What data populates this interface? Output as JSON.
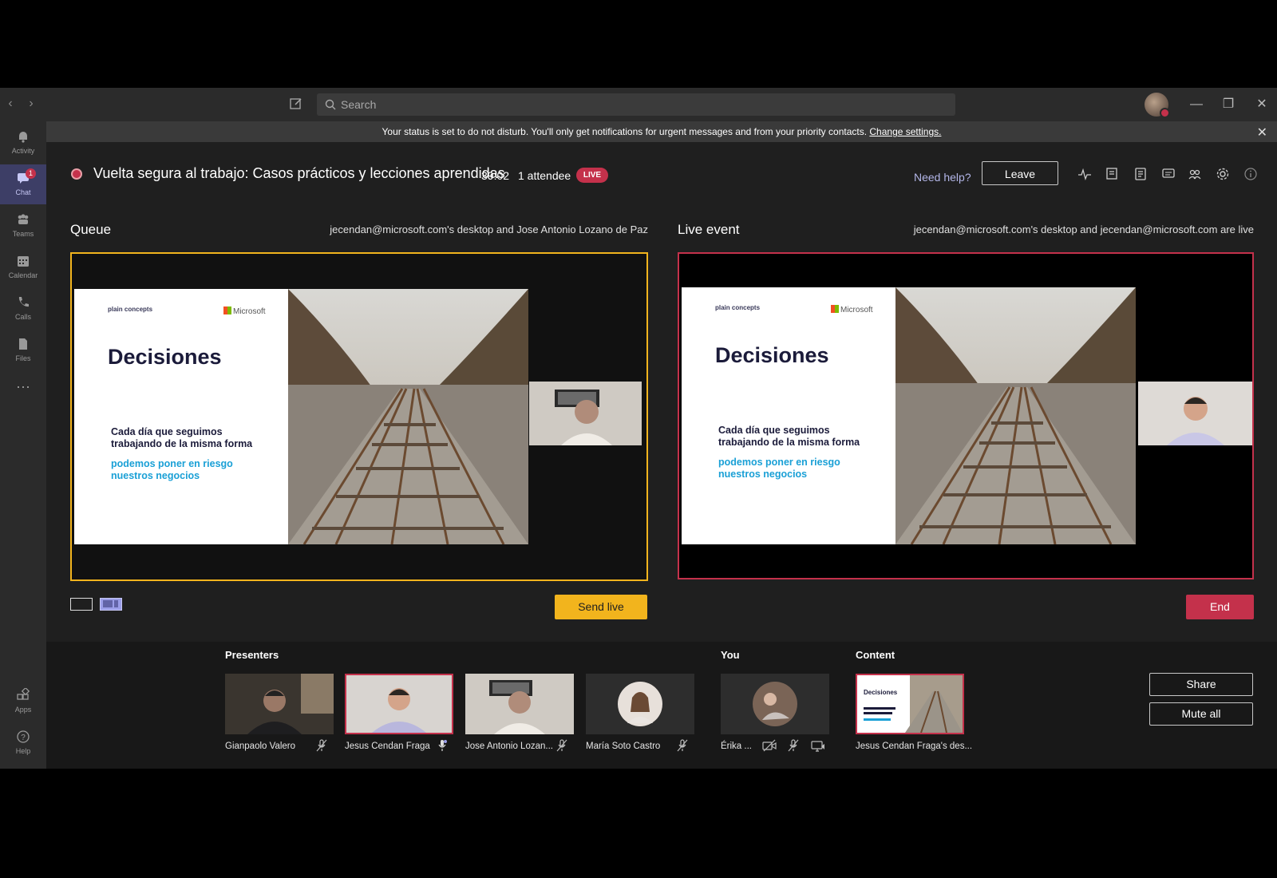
{
  "search": {
    "placeholder": "Search"
  },
  "rail": {
    "items": [
      {
        "label": "Activity"
      },
      {
        "label": "Chat",
        "badge": "1"
      },
      {
        "label": "Teams"
      },
      {
        "label": "Calendar"
      },
      {
        "label": "Calls"
      },
      {
        "label": "Files"
      },
      {
        "label": "Apps"
      },
      {
        "label": "Help"
      }
    ]
  },
  "notification": {
    "message": "Your status is set to do not disturb. You'll only get notifications for urgent messages and from your priority contacts.",
    "link": "Change settings."
  },
  "meeting": {
    "title": "Vuelta segura al trabajo: Casos prácticos y lecciones aprendidas",
    "timer": "39:02",
    "attendees": "1 attendee",
    "live_badge": "LIVE",
    "need_help": "Need help?",
    "leave": "Leave"
  },
  "queue": {
    "title": "Queue",
    "subtitle": "jecendan@microsoft.com's desktop and Jose Antonio Lozano de Paz",
    "send_live": "Send live"
  },
  "live_event": {
    "title": "Live event",
    "subtitle": "jecendan@microsoft.com's desktop and jecendan@microsoft.com are live",
    "end": "End"
  },
  "slide": {
    "logo": "plain concepts",
    "brand": "Microsoft",
    "heading": "Decisiones",
    "line1": "Cada día que seguimos trabajando de la misma forma",
    "line2": "podemos poner en riesgo nuestros negocios"
  },
  "presenters": {
    "label": "Presenters",
    "people": [
      {
        "name": "Gianpaolo Valero"
      },
      {
        "name": "Jesus Cendan Fraga"
      },
      {
        "name": "Jose Antonio Lozan..."
      },
      {
        "name": "María Soto Castro"
      }
    ]
  },
  "you": {
    "label": "You",
    "name": "Érika ..."
  },
  "content": {
    "label": "Content",
    "name": "Jesus Cendan Fraga's des..."
  },
  "actions": {
    "share": "Share",
    "mute_all": "Mute all"
  },
  "colors": {
    "queue_accent": "#f2b41d",
    "live_accent": "#c4314b",
    "rail_active": "#3d3e66",
    "link": "#b3b6e8"
  }
}
